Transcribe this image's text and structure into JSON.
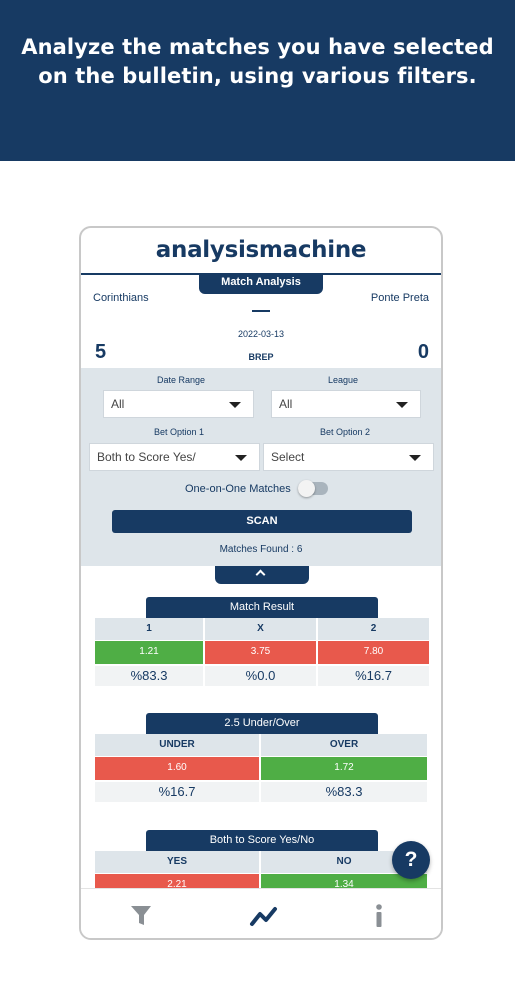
{
  "banner": {
    "line1": "Analyze the matches you have selected",
    "line2": "on the bulletin, using various filters."
  },
  "app": {
    "logo": "analysismachine",
    "tab_title": "Match Analysis"
  },
  "match": {
    "home_team": "Corinthians",
    "away_team": "Ponte Preta",
    "date": "2022-03-13",
    "league_code": "BREP",
    "home_score": "5",
    "away_score": "0"
  },
  "filters": {
    "date_range_label": "Date Range",
    "date_range_value": "All",
    "league_label": "League",
    "league_value": "All",
    "bet1_label": "Bet Option 1",
    "bet1_value": "Both to Score Yes/",
    "bet2_label": "Bet Option 2",
    "bet2_value": "Select",
    "one_on_one_label": "One-on-One Matches",
    "one_on_one_enabled": false,
    "scan_label": "SCAN",
    "matches_found": "Matches Found : 6"
  },
  "match_result": {
    "title": "Match Result",
    "headers": [
      "1",
      "X",
      "2"
    ],
    "odds": [
      "1.21",
      "3.75",
      "7.80"
    ],
    "odds_colors": [
      "green",
      "red",
      "red"
    ],
    "percents": [
      "%83.3",
      "%0.0",
      "%16.7"
    ]
  },
  "under_over": {
    "title": "2.5 Under/Over",
    "headers": [
      "UNDER",
      "OVER"
    ],
    "odds": [
      "1.60",
      "1.72"
    ],
    "odds_colors": [
      "red",
      "green"
    ],
    "percents": [
      "%16.7",
      "%83.3"
    ]
  },
  "both_to_score": {
    "title": "Both to Score Yes/No",
    "headers": [
      "YES",
      "NO"
    ],
    "odds": [
      "2.21",
      "1.34"
    ],
    "odds_colors": [
      "red",
      "green"
    ]
  },
  "help": {
    "label": "?"
  },
  "nav": {
    "items": [
      "filter-icon",
      "chart-trend-icon",
      "info-icon"
    ],
    "icon_color": "#173a63",
    "muted_color": "#8a8f94"
  },
  "colors": {
    "brand_navy": "#173a63",
    "panel_gray": "#dee5ea",
    "odds_red": "#e8594c",
    "odds_green": "#4fae45"
  }
}
